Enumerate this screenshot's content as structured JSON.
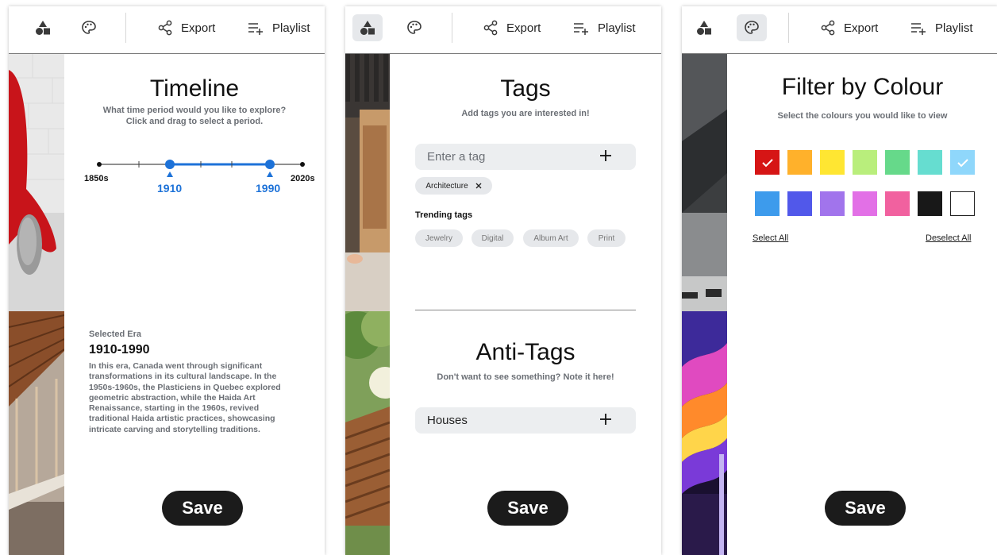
{
  "toolbar": {
    "export_label": "Export",
    "playlist_label": "Playlist"
  },
  "timeline": {
    "title": "Timeline",
    "subtitle_line1": "What time period would you like to explore?",
    "subtitle_line2": "Click and drag to select a period.",
    "start_label": "1850s",
    "end_label": "2020s",
    "selected_start": "1910",
    "selected_end": "1990",
    "era_label": "Selected Era",
    "era_range": "1910-1990",
    "era_description": [
      "In this era, Canada went through significant",
      "transformations in its cultural landscape. In the",
      "1950s-1960s, the Plasticiens in Quebec explored",
      "geometric abstraction, while the Haida Art",
      "Renaissance, starting in the 1960s, revived",
      "traditional Haida artistic practices, showcasing",
      "intricate carving and storytelling traditions."
    ],
    "save_label": "Save"
  },
  "tags": {
    "title": "Tags",
    "subtitle": "Add tags you are interested in!",
    "input_placeholder": "Enter a tag",
    "selected_tags": [
      "Architecture"
    ],
    "trending_title": "Trending tags",
    "trending_tags": [
      "Jewelry",
      "Digital",
      "Album Art",
      "Print"
    ],
    "anti_title": "Anti-Tags",
    "anti_subtitle": "Don't want to see something? Note it here!",
    "anti_input_value": "Houses",
    "save_label": "Save"
  },
  "colour": {
    "title": "Filter by Colour",
    "subtitle": "Select the colours you would like to view",
    "swatches_row1": [
      {
        "hex": "#d61515",
        "selected": true
      },
      {
        "hex": "#ffb12b",
        "selected": false
      },
      {
        "hex": "#ffe632",
        "selected": false
      },
      {
        "hex": "#b9ee7c",
        "selected": false
      },
      {
        "hex": "#66d98a",
        "selected": false
      },
      {
        "hex": "#66ddd0",
        "selected": false
      },
      {
        "hex": "#8fd7fb",
        "selected": true
      }
    ],
    "swatches_row2": [
      {
        "hex": "#3d9bec",
        "selected": false
      },
      {
        "hex": "#5158ea",
        "selected": false
      },
      {
        "hex": "#a174ec",
        "selected": false
      },
      {
        "hex": "#e270e6",
        "selected": false
      },
      {
        "hex": "#f1619f",
        "selected": false
      },
      {
        "hex": "#181818",
        "selected": false
      },
      {
        "hex": "#ffffff",
        "selected": false
      }
    ],
    "select_all_label": "Select All",
    "deselect_all_label": "Deselect All",
    "save_label": "Save"
  },
  "colors": {
    "accent_blue": "#1d72d8",
    "button_dark": "#1b1b1b",
    "muted_text": "#6b6f75"
  }
}
